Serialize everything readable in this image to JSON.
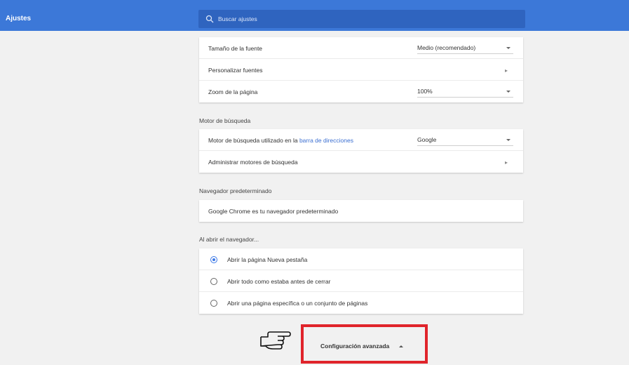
{
  "header": {
    "title": "Ajustes",
    "search_placeholder": "Buscar ajustes"
  },
  "appearance": {
    "font_size_label": "Tamaño de la fuente",
    "font_size_value": "Medio (recomendado)",
    "custom_fonts_label": "Personalizar fuentes",
    "zoom_label": "Zoom de la página",
    "zoom_value": "100%"
  },
  "search_engine": {
    "section_title": "Motor de búsqueda",
    "engine_label_prefix": "Motor de búsqueda utilizado en la ",
    "engine_label_link": "barra de direcciones",
    "engine_value": "Google",
    "manage_label": "Administrar motores de búsqueda"
  },
  "default_browser": {
    "section_title": "Navegador predeterminado",
    "status": "Google Chrome es tu navegador predeterminado"
  },
  "on_startup": {
    "section_title": "Al abrir el navegador...",
    "options": [
      {
        "label": "Abrir la página Nueva pestaña",
        "checked": true
      },
      {
        "label": "Abrir todo como estaba antes de cerrar",
        "checked": false
      },
      {
        "label": "Abrir una página específica o un conjunto de páginas",
        "checked": false
      }
    ]
  },
  "advanced": {
    "label": "Configuración avanzada"
  },
  "colors": {
    "header": "#3c78d8",
    "accent": "#3b78e7",
    "highlight": "#e0242b"
  }
}
